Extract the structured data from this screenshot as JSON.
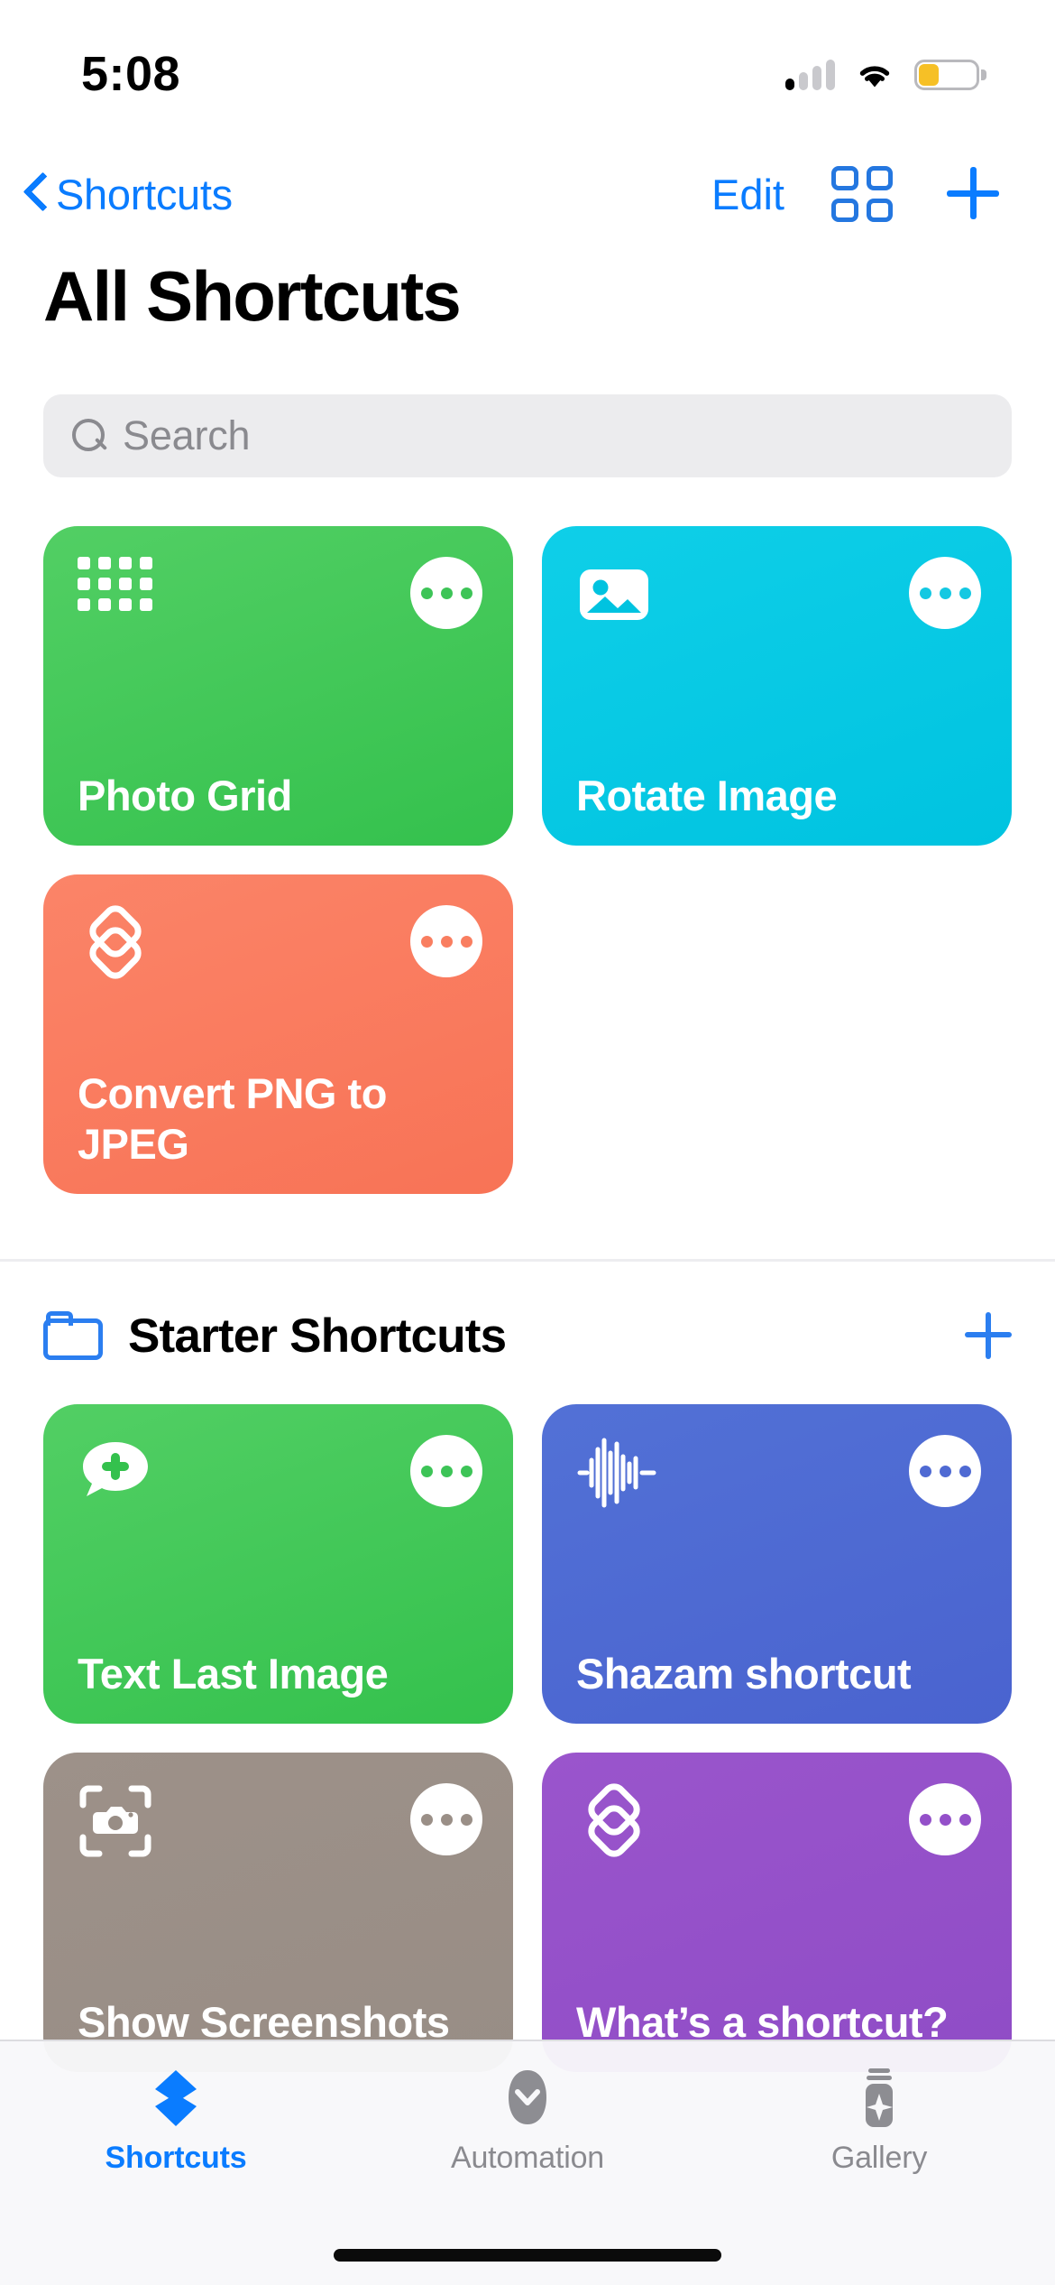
{
  "status_bar": {
    "time": "5:08",
    "signal_icon": "cellular-signal-icon",
    "signal_bars_filled": 1,
    "signal_bars_total": 4,
    "wifi_icon": "wifi-icon",
    "battery_icon": "battery-icon",
    "battery_fill_percent": 30,
    "battery_color": "#f6c026"
  },
  "nav_bar": {
    "back_icon": "chevron-left-icon",
    "back_label": "Shortcuts",
    "edit_label": "Edit",
    "grid_icon": "grid-layout-icon",
    "add_icon": "plus-icon",
    "accent_color": "#0a7cff"
  },
  "page_title": "All Shortcuts",
  "search": {
    "icon": "search-icon",
    "placeholder": "Search",
    "value": ""
  },
  "all_shortcuts": {
    "cards": [
      {
        "title": "Photo Grid",
        "color": "#3dc457",
        "color_class": "c-green",
        "glyph": "dot-grid-icon",
        "more_icon": "more-ellipsis-icon"
      },
      {
        "title": "Rotate Image",
        "color": "#14c8e2",
        "color_class": "c-cyan",
        "glyph": "photo-icon",
        "more_icon": "more-ellipsis-icon"
      },
      {
        "title": "Convert PNG to JPEG",
        "color": "#f97e60",
        "color_class": "c-salmon",
        "glyph": "shortcuts-layers-icon",
        "more_icon": "more-ellipsis-icon"
      }
    ]
  },
  "starter_section": {
    "folder_icon": "folder-icon",
    "title": "Starter Shortcuts",
    "add_icon": "plus-icon",
    "cards": [
      {
        "title": "Text Last Image",
        "color": "#3dc457",
        "color_class": "c-green2",
        "glyph": "message-plus-icon",
        "more_icon": "more-ellipsis-icon"
      },
      {
        "title": "Shazam shortcut",
        "color": "#4f6ad3",
        "color_class": "c-indigo",
        "glyph": "waveform-icon",
        "more_icon": "more-ellipsis-icon"
      },
      {
        "title": "Show Screenshots",
        "color": "#9a8f87",
        "color_class": "c-taupe",
        "glyph": "camera-viewfinder-icon",
        "more_icon": "more-ellipsis-icon"
      },
      {
        "title": "What’s a shortcut?",
        "color": "#9450c9",
        "color_class": "c-purple",
        "glyph": "shortcuts-layers-icon",
        "more_icon": "more-ellipsis-icon"
      }
    ]
  },
  "tab_bar": {
    "active_color": "#0a7cff",
    "inactive_color": "#8a8a8f",
    "tabs": [
      {
        "label": "Shortcuts",
        "icon": "shortcuts-layers-icon",
        "active": true
      },
      {
        "label": "Automation",
        "icon": "automation-check-icon",
        "active": false
      },
      {
        "label": "Gallery",
        "icon": "gallery-jar-icon",
        "active": false
      }
    ]
  }
}
